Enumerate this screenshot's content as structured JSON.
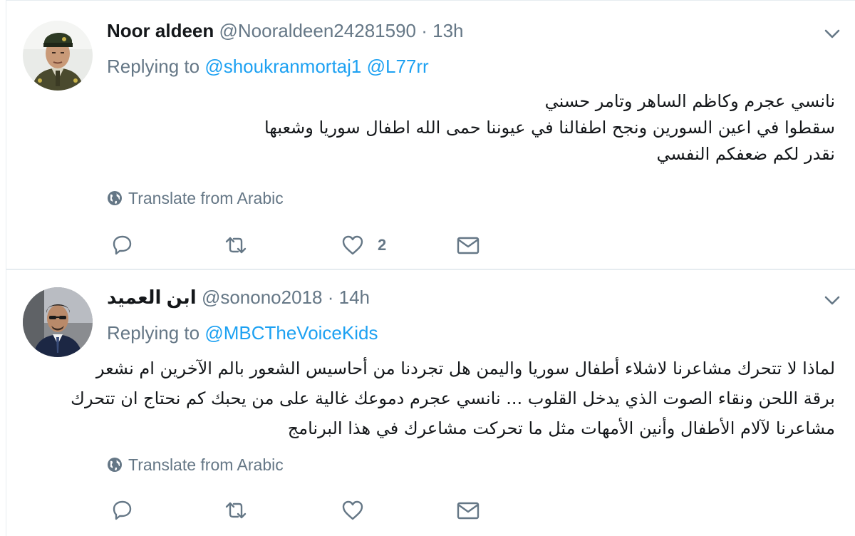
{
  "tweets": [
    {
      "name": "Noor aldeen",
      "handle": "@Nooraldeen24281590",
      "dot": "·",
      "time": "13h",
      "replying_prefix": "Replying to",
      "mentions": [
        "@shoukranmortaj1",
        "@L77rr"
      ],
      "body_lines": [
        "نانسي عجرم وكاظم الساهر  وتامر حسني",
        " سقطوا في اعين السورين  ونجح اطفالنا في عيوننا  حمى الله اطفال سوريا وشعبها",
        "نقدر لكم ضعفكم  النفسي"
      ],
      "translate_label": "Translate from Arabic",
      "like_count": "2",
      "icons": [
        "chevron-down-icon",
        "globe-icon",
        "reply-icon",
        "retweet-icon",
        "heart-icon",
        "envelope-icon"
      ]
    },
    {
      "name": "ابن العميد",
      "handle": "@sonono2018",
      "dot": "·",
      "time": "14h",
      "replying_prefix": "Replying to",
      "mentions": [
        "@MBCTheVoiceKids"
      ],
      "body_lines": [
        "لماذا لا تتحرك مشاعرنا لاشلاء أطفال سوريا واليمن هل تجردنا من أحاسيس الشعور بالم الآخرين ام نشعر",
        "برقة اللحن ونقاء الصوت الذي يدخل القلوب ... نانسي عجرم دموعك غالية على من يحبك كم نحتاج ان تتحرك",
        "مشاعرنا لآلام الأطفال وأنين الأمهات مثل ما تحركت مشاعرك في هذا البرنامج"
      ],
      "translate_label": "Translate from Arabic",
      "like_count": "",
      "icons": [
        "chevron-down-icon",
        "globe-icon",
        "reply-icon",
        "retweet-icon",
        "heart-icon",
        "envelope-icon"
      ]
    }
  ],
  "colors": {
    "text": "#14171a",
    "secondary": "#657786",
    "link": "#1da1f2",
    "border": "#e6ecf0"
  }
}
